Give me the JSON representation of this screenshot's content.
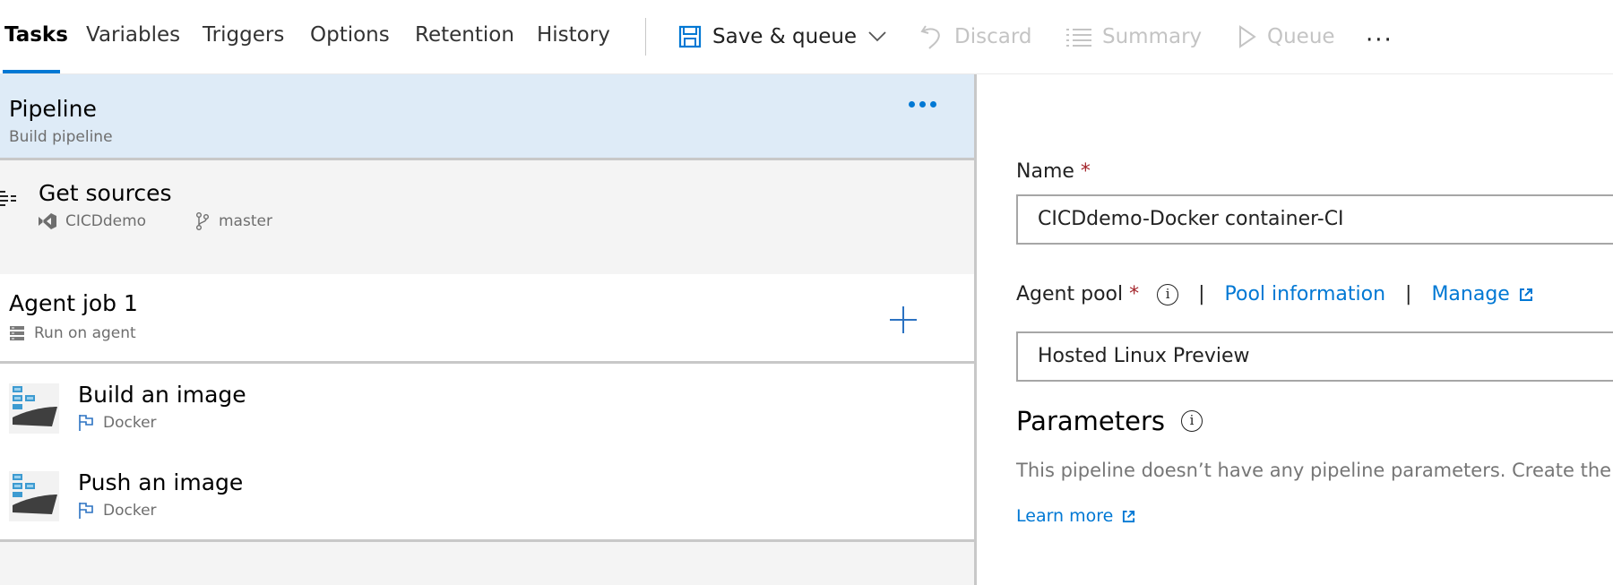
{
  "tabs": [
    {
      "label": "Tasks",
      "active": true
    },
    {
      "label": "Variables"
    },
    {
      "label": "Triggers"
    },
    {
      "label": "Options"
    },
    {
      "label": "Retention"
    },
    {
      "label": "History"
    }
  ],
  "toolbar": {
    "save_queue": "Save & queue",
    "discard": "Discard",
    "summary": "Summary",
    "queue": "Queue",
    "more": "···"
  },
  "pipeline": {
    "title": "Pipeline",
    "subtitle": "Build pipeline"
  },
  "get_sources": {
    "title": "Get sources",
    "repo": "CICDdemo",
    "branch": "master"
  },
  "agent_job": {
    "title": "Agent job 1",
    "subtitle": "Run on agent"
  },
  "tasks": [
    {
      "title": "Build an image",
      "subtitle": "Docker"
    },
    {
      "title": "Push an image",
      "subtitle": "Docker"
    }
  ],
  "form": {
    "name_label": "Name",
    "required_mark": "*",
    "name_value": "CICDdemo-Docker container-CI",
    "agent_pool_label": "Agent pool",
    "pool_information": "Pool information",
    "separator": "|",
    "manage": "Manage",
    "agent_pool_value": "Hosted Linux Preview",
    "parameters_heading": "Parameters",
    "parameters_desc": "This pipeline doesn’t have any pipeline parameters. Create the",
    "learn_more": "Learn more"
  },
  "colors": {
    "accent": "#0078d4",
    "selected_row": "#deebf7",
    "required": "#a4262c"
  }
}
